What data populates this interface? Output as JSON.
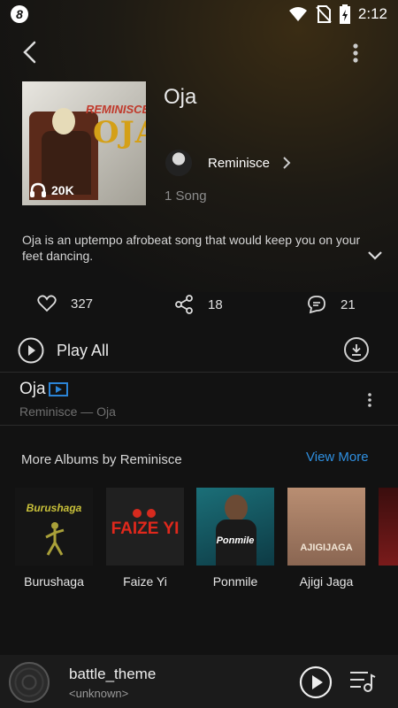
{
  "status_bar": {
    "time": "2:12",
    "app_logo": "8"
  },
  "album": {
    "title": "Oja",
    "cover_artist_text": "REMINISCE",
    "cover_title_text": "OJA",
    "play_count": "20K",
    "artist": "Reminisce",
    "song_count": "1 Song",
    "description": "Oja is an uptempo afrobeat song that would keep you on your feet dancing."
  },
  "stats": {
    "likes": "327",
    "shares": "18",
    "comments": "21"
  },
  "play_all_label": "Play All",
  "song": {
    "title": "Oja",
    "subtitle": "Reminisce — Oja"
  },
  "more_albums": {
    "title": "More Albums by Reminisce",
    "view_more": "View More",
    "items": [
      {
        "name": "Burushaga",
        "cover_text": "Burushaga"
      },
      {
        "name": "Faize Yi",
        "cover_text": "FAIZE YI"
      },
      {
        "name": "Ponmile",
        "cover_text": "Ponmile"
      },
      {
        "name": "Ajigi Jaga",
        "cover_text": "AJIGIJAGA"
      }
    ]
  },
  "player": {
    "track": "battle_theme",
    "artist": "<unknown>"
  },
  "colors": {
    "accent": "#2f8fe0",
    "background": "#121212"
  }
}
